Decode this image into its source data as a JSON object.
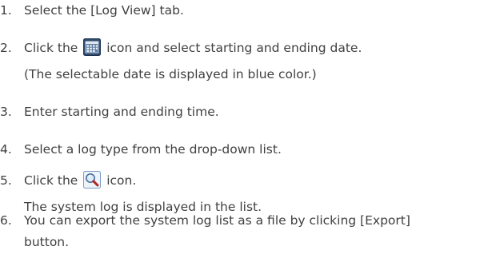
{
  "steps": [
    {
      "number": "1.",
      "lines": [
        "Select the [Log View] tab."
      ]
    },
    {
      "number": "2.",
      "line1_before_icon": "Click the",
      "line1_after_icon": "icon and select starting and ending date.",
      "line2": "(The selectable date is displayed in blue color.)",
      "icon": "calendar-icon"
    },
    {
      "number": "3.",
      "lines": [
        "Enter starting and ending time."
      ]
    },
    {
      "number": "4.",
      "lines": [
        "Select a log type from the drop-down list."
      ]
    },
    {
      "number": "5.",
      "line1_before_icon": "Click the",
      "line1_after_icon": "icon.",
      "line2": "The system log is displayed in the list.",
      "icon": "magnifier-search-icon"
    },
    {
      "number": "6.",
      "lines": [
        "You can export the system log list as a file by clicking [Export]",
        "button."
      ]
    }
  ],
  "colors": {
    "text": "#404040",
    "calendar_icon_bg": "#2f4b6e",
    "search_icon_frame": "#7a9cc9"
  }
}
